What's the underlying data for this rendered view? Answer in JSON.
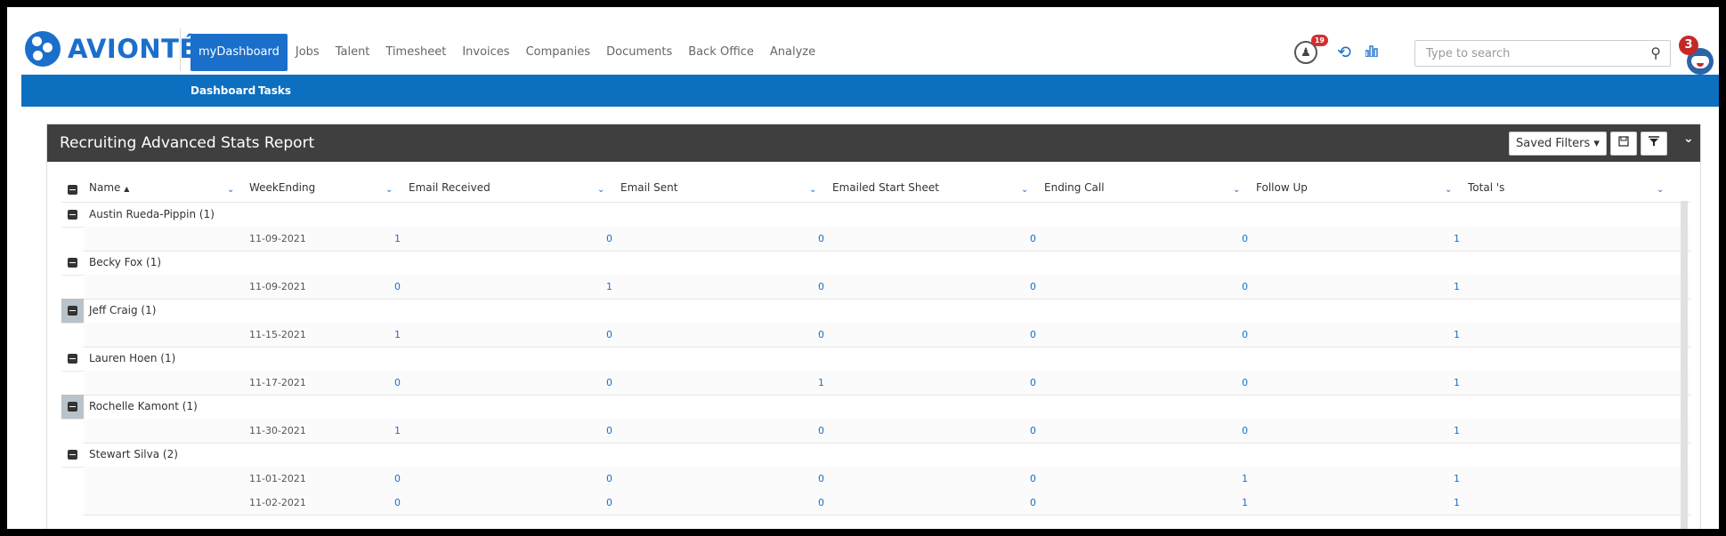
{
  "app": {
    "logo_text": "AVIONTÉ",
    "nav": [
      "myDashboard",
      "Jobs",
      "Talent",
      "Timesheet",
      "Invoices",
      "Companies",
      "Documents",
      "Back Office",
      "Analyze"
    ],
    "active_nav": "myDashboard",
    "notification_count": "19",
    "avatar_badge": "3",
    "search_placeholder": "Type to search",
    "sub_nav": [
      "Dashboard",
      "Tasks"
    ]
  },
  "report": {
    "title": "Recruiting Advanced Stats Report",
    "saved_filters_label": "Saved Filters ▾",
    "columns": [
      "Name",
      "WeekEnding",
      "Email Received",
      "Email Sent",
      "Emailed Start Sheet",
      "Ending Call",
      "Follow Up",
      "Total 's"
    ],
    "groups": [
      {
        "name": "Austin Rueda-Pippin (1)",
        "highlight": false,
        "rows": [
          [
            "11-09-2021",
            "1",
            "0",
            "0",
            "0",
            "0",
            "1"
          ]
        ]
      },
      {
        "name": "Becky Fox (1)",
        "highlight": false,
        "rows": [
          [
            "11-09-2021",
            "0",
            "1",
            "0",
            "0",
            "0",
            "1"
          ]
        ]
      },
      {
        "name": "Jeff Craig (1)",
        "highlight": true,
        "rows": [
          [
            "11-15-2021",
            "1",
            "0",
            "0",
            "0",
            "0",
            "1"
          ]
        ]
      },
      {
        "name": "Lauren Hoen (1)",
        "highlight": false,
        "rows": [
          [
            "11-17-2021",
            "0",
            "0",
            "1",
            "0",
            "0",
            "1"
          ]
        ]
      },
      {
        "name": "Rochelle Kamont (1)",
        "highlight": true,
        "rows": [
          [
            "11-30-2021",
            "1",
            "0",
            "0",
            "0",
            "0",
            "1"
          ]
        ]
      },
      {
        "name": "Stewart Silva (2)",
        "highlight": false,
        "rows": [
          [
            "11-01-2021",
            "0",
            "0",
            "0",
            "0",
            "1",
            "1"
          ],
          [
            "11-02-2021",
            "0",
            "0",
            "0",
            "0",
            "1",
            "1"
          ]
        ]
      }
    ]
  }
}
